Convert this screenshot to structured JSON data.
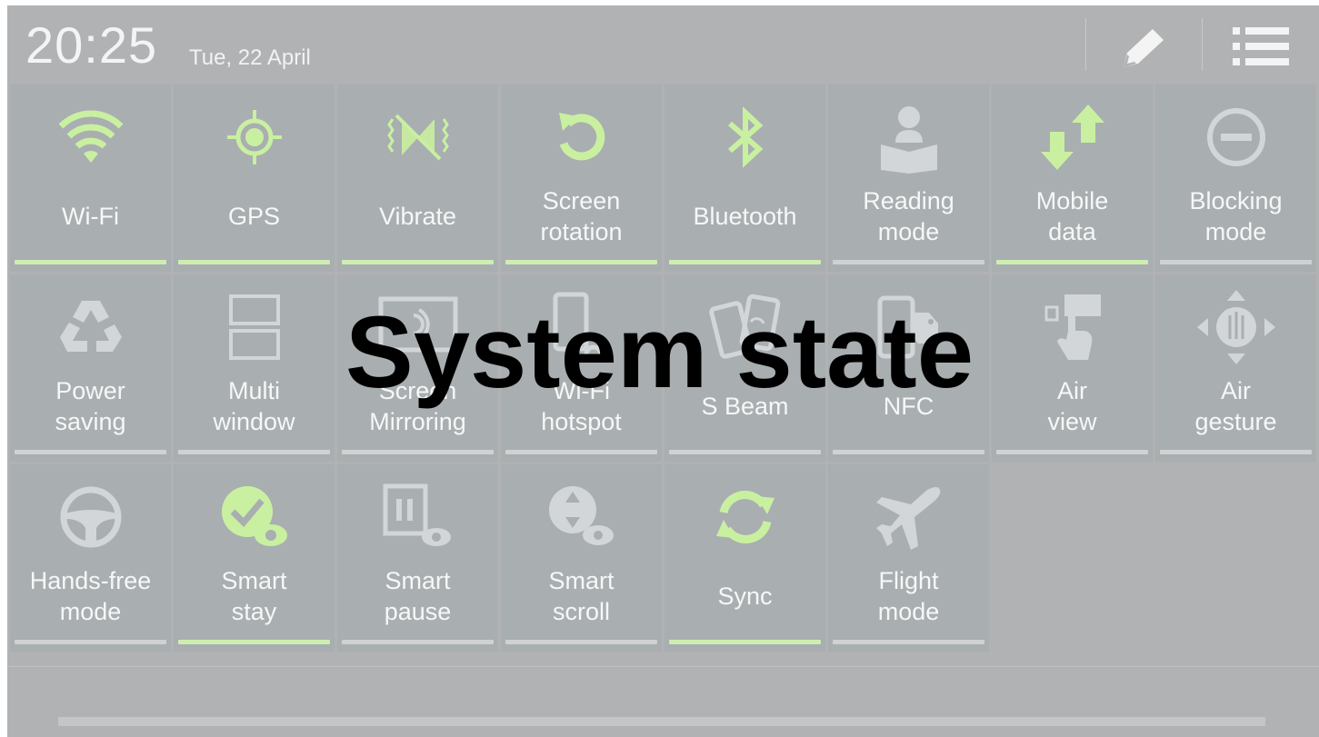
{
  "status": {
    "time": "20:25",
    "date": "Tue, 22 April",
    "edit_icon": "pencil-icon",
    "menu_icon": "list-menu-icon"
  },
  "tiles": [
    {
      "label": "Wi-Fi",
      "icon": "wifi-icon",
      "on": true
    },
    {
      "label": "GPS",
      "icon": "gps-icon",
      "on": true
    },
    {
      "label": "Vibrate",
      "icon": "vibrate-icon",
      "on": true
    },
    {
      "label": "Screen\nrotation",
      "icon": "rotation-icon",
      "on": true
    },
    {
      "label": "Bluetooth",
      "icon": "bluetooth-icon",
      "on": true
    },
    {
      "label": "Reading\nmode",
      "icon": "reading-icon",
      "on": false
    },
    {
      "label": "Mobile\ndata",
      "icon": "mobile-data-icon",
      "on": true
    },
    {
      "label": "Blocking\nmode",
      "icon": "blocking-icon",
      "on": false
    },
    {
      "label": "Power\nsaving",
      "icon": "recycle-icon",
      "on": false
    },
    {
      "label": "Multi\nwindow",
      "icon": "multi-window-icon",
      "on": false
    },
    {
      "label": "Screen\nMirroring",
      "icon": "screen-mirroring-icon",
      "on": false
    },
    {
      "label": "Wi-Fi\nhotspot",
      "icon": "hotspot-icon",
      "on": false
    },
    {
      "label": "S Beam",
      "icon": "s-beam-icon",
      "on": false
    },
    {
      "label": "NFC",
      "icon": "nfc-icon",
      "on": false
    },
    {
      "label": "Air\nview",
      "icon": "air-view-icon",
      "on": false
    },
    {
      "label": "Air\ngesture",
      "icon": "air-gesture-icon",
      "on": false
    },
    {
      "label": "Hands-free\nmode",
      "icon": "steering-wheel-icon",
      "on": false
    },
    {
      "label": "Smart\nstay",
      "icon": "smart-stay-icon",
      "on": true
    },
    {
      "label": "Smart\npause",
      "icon": "smart-pause-icon",
      "on": false
    },
    {
      "label": "Smart\nscroll",
      "icon": "smart-scroll-icon",
      "on": false
    },
    {
      "label": "Sync",
      "icon": "sync-icon",
      "on": true
    },
    {
      "label": "Flight\nmode",
      "icon": "airplane-icon",
      "on": false
    }
  ],
  "overlay_text": "System state",
  "colors": {
    "active_green": "#cdeeb0",
    "inactive_bar": "#cfd2d3",
    "icon_green": "#c9f0a0",
    "icon_gray": "#d2d6d8"
  }
}
